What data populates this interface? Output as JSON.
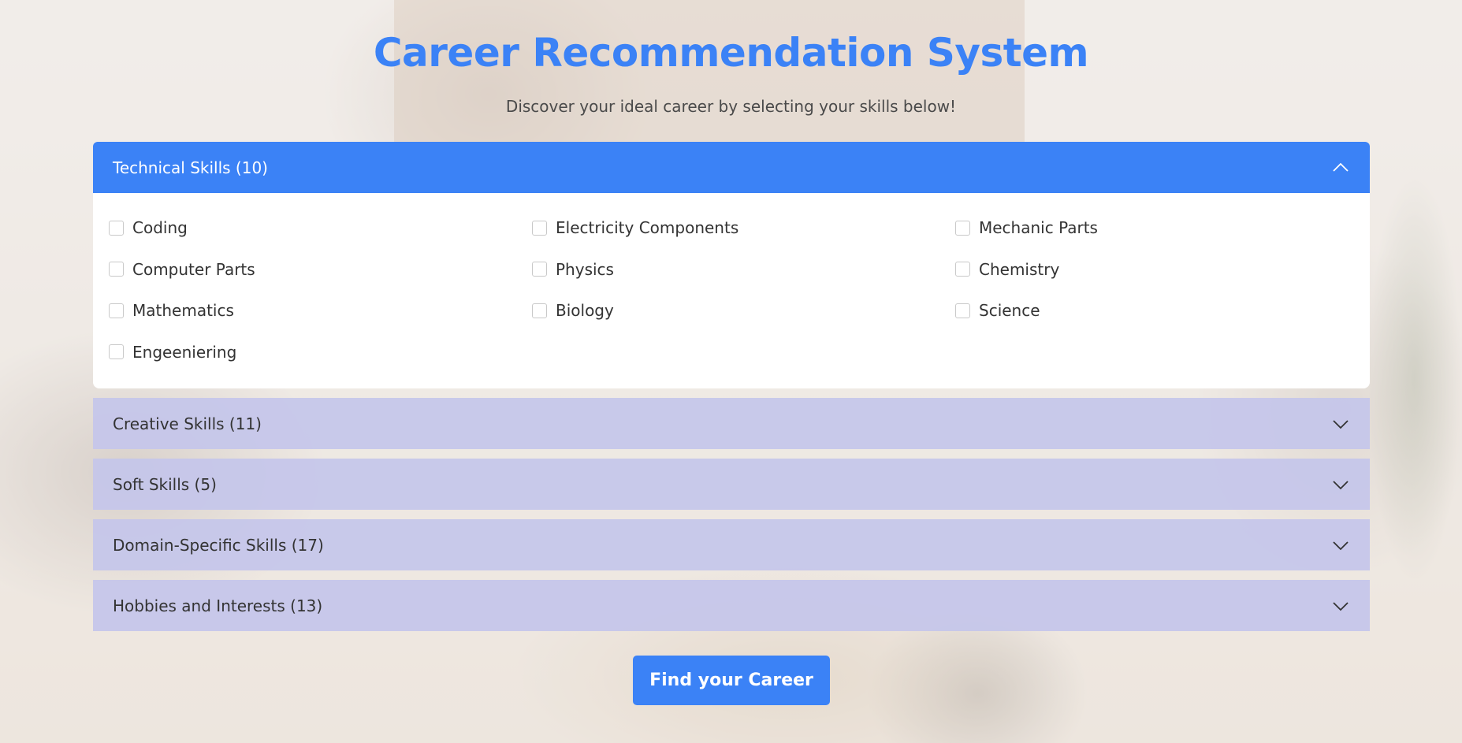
{
  "header": {
    "title": "Career Recommendation System",
    "subtitle": "Discover your ideal career by selecting your skills below!"
  },
  "colors": {
    "accent": "#3b82f6",
    "collapsed_header": "#c4c6ea"
  },
  "sections": [
    {
      "label": "Technical Skills (10)",
      "expanded": true,
      "icon": "chevron-up-icon",
      "options": [
        {
          "label": "Coding",
          "checked": false
        },
        {
          "label": "Electricity Components",
          "checked": false
        },
        {
          "label": "Mechanic Parts",
          "checked": false
        },
        {
          "label": "Computer Parts",
          "checked": false
        },
        {
          "label": "Physics",
          "checked": false
        },
        {
          "label": "Chemistry",
          "checked": false
        },
        {
          "label": "Mathematics",
          "checked": false
        },
        {
          "label": "Biology",
          "checked": false
        },
        {
          "label": "Science",
          "checked": false
        },
        {
          "label": "Engeeniering",
          "checked": false
        }
      ]
    },
    {
      "label": "Creative Skills (11)",
      "expanded": false,
      "icon": "chevron-down-icon"
    },
    {
      "label": "Soft Skills (5)",
      "expanded": false,
      "icon": "chevron-down-icon"
    },
    {
      "label": "Domain-Specific Skills (17)",
      "expanded": false,
      "icon": "chevron-down-icon"
    },
    {
      "label": "Hobbies and Interests (13)",
      "expanded": false,
      "icon": "chevron-down-icon"
    }
  ],
  "actions": {
    "find_label": "Find your Career"
  }
}
